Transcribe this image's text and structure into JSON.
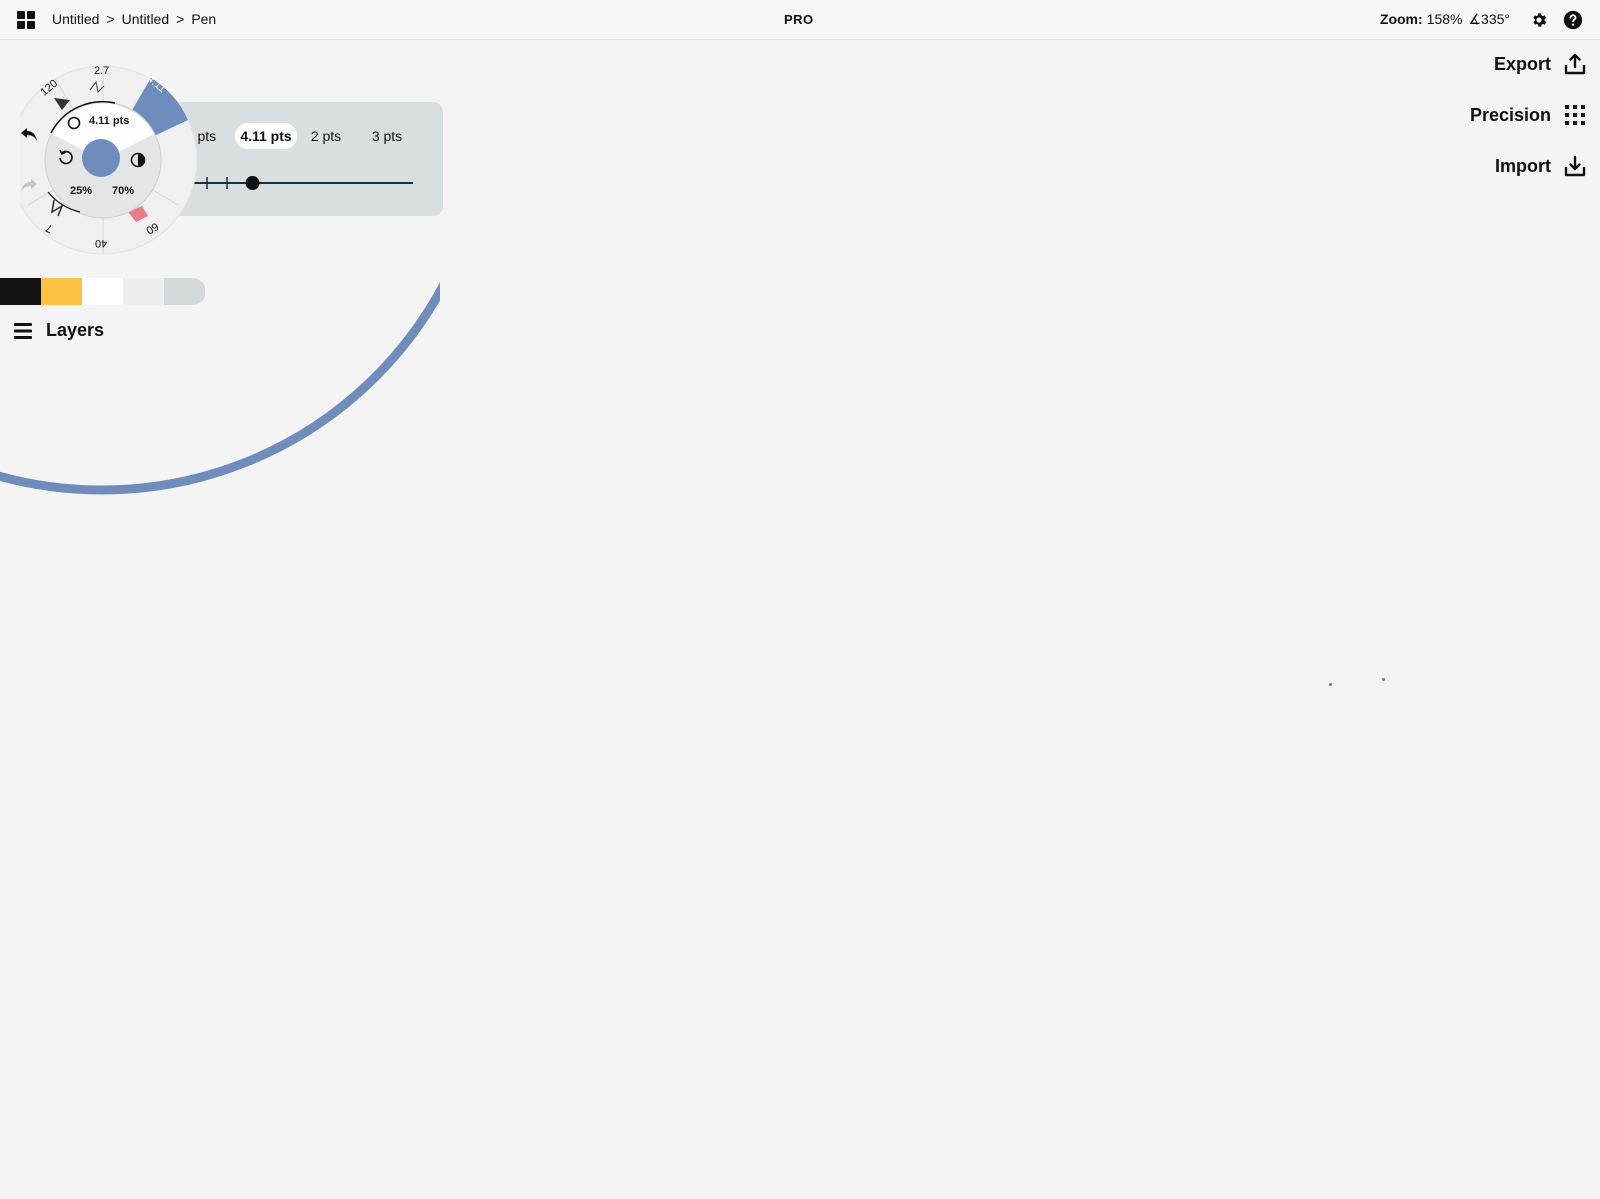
{
  "breadcrumb": [
    "Untitled",
    "Untitled",
    "Pen"
  ],
  "breadcrumb_separator": ">",
  "pro_label": "PRO",
  "zoom": {
    "label": "Zoom:",
    "value": "158%",
    "angle": "∡335°"
  },
  "side_menu": {
    "export_label": "Export",
    "precision_label": "Precision",
    "import_label": "Import"
  },
  "wheel": {
    "brush_size_label": "4.11 pts",
    "opacity_label": "25%",
    "smoothing_label": "70%",
    "presets": [
      "2.7",
      "4.11",
      "120",
      "7",
      "40",
      "60"
    ],
    "current_color": "#6e8dbd"
  },
  "size_options": [
    ".5 pts",
    "4.11 pts",
    "2 pts",
    "3 pts"
  ],
  "size_selected": "4.11 pts",
  "size_slider_fraction": 0.32,
  "palette": [
    "#141312",
    "#fdc143",
    "#ffffff",
    "#eeeeee",
    "#d4d9dc"
  ],
  "layers_label": "Layers",
  "colors": {
    "accent_ring": "#6e8dbd",
    "canvas": "#f4f4f4",
    "panel": "#d9dee0"
  }
}
